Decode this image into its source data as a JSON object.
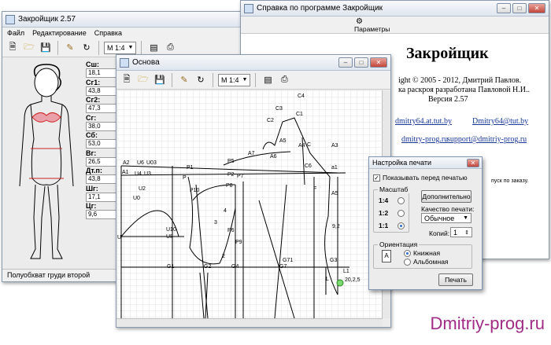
{
  "main_window": {
    "title": "Закройщик 2.57",
    "menu": [
      "Файл",
      "Редактирование",
      "Справка"
    ],
    "scale": "М 1:4",
    "measurements": [
      {
        "label": "Сш:",
        "value": "18,1"
      },
      {
        "label": "Сг1:",
        "value": "43,8"
      },
      {
        "label": "Сг2:",
        "value": "47,3"
      },
      {
        "label": "Сг:",
        "value": "38,0"
      },
      {
        "label": "Сб:",
        "value": "53,0"
      },
      {
        "label": "Вг:",
        "value": "26,5"
      },
      {
        "label": "Дт.п:",
        "value": "43,8"
      },
      {
        "label": "Шг:",
        "value": "17,1"
      },
      {
        "label": "Цг:",
        "value": "9,6"
      }
    ],
    "status": "Полуобхват груди второй"
  },
  "help_window": {
    "title": "Справка по программе Закройщик",
    "params_label": "Параметры",
    "heading": "Закройщик",
    "copyright": "ight © 2005 - 2012, Дмитрий Павлов.",
    "method": "ка раскроя разработана Павловой Н.И..",
    "version": "Версия 2.57",
    "link1": "dmitry64.at.tut.by",
    "link2": "Dmitry64@tut.by",
    "link3": "dmitry-prog.ru",
    "link4": "support@dmitriy-prog.ru",
    "note": "пуск по заказу."
  },
  "osnova_window": {
    "title": "Основа",
    "scale": "М 1:4",
    "points": [
      "A2",
      "U6",
      "U03",
      "A1",
      "U4",
      "U3",
      "U2",
      "U0",
      "U",
      "P1",
      "P",
      "P10",
      "P5",
      "P2",
      "P6",
      "P9",
      "P8",
      "P7",
      "A7",
      "A6",
      "A5",
      "A4",
      "C",
      "C3",
      "C4",
      "C2",
      "C1",
      "C6",
      "A3",
      "a1",
      "F",
      "A5",
      "9,2",
      "L1",
      "L",
      "G1",
      "G2",
      "G3",
      "G4",
      "G71",
      "G7",
      "U10",
      "U8",
      "2",
      "3",
      "4",
      "20,2,5"
    ]
  },
  "print_dialog": {
    "title": "Настройка печати",
    "preview_label": "Показывать перед печатью",
    "scale_group": "Масштаб",
    "scale_options": [
      "1:4",
      "1:2",
      "1:1"
    ],
    "selected_scale": "1:1",
    "advanced_button": "Дополнительно",
    "quality_label": "Качество печати:",
    "quality_value": "Обычное",
    "copies_label": "Копий:",
    "copies_value": "1",
    "orientation_group": "Ориентация",
    "orientation_options": [
      "Книжная",
      "Альбомная"
    ],
    "selected_orientation": "Книжная",
    "print_button": "Печать"
  },
  "watermark": "Dmitriy-prog.ru"
}
